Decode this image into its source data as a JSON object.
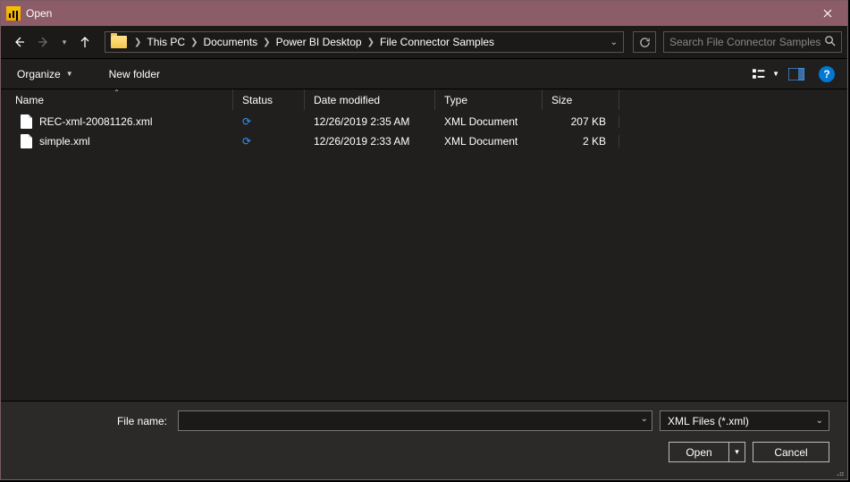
{
  "titlebar": {
    "title": "Open"
  },
  "breadcrumbs": [
    "This PC",
    "Documents",
    "Power BI Desktop",
    "File Connector Samples"
  ],
  "search": {
    "placeholder": "Search File Connector Samples"
  },
  "toolbar": {
    "organize": "Organize",
    "newfolder": "New folder"
  },
  "columns": {
    "name": "Name",
    "status": "Status",
    "date": "Date modified",
    "type": "Type",
    "size": "Size"
  },
  "files": [
    {
      "name": "REC-xml-20081126.xml",
      "date": "12/26/2019 2:35 AM",
      "type": "XML Document",
      "size": "207 KB"
    },
    {
      "name": "simple.xml",
      "date": "12/26/2019 2:33 AM",
      "type": "XML Document",
      "size": "2 KB"
    }
  ],
  "bottom": {
    "filename_label": "File name:",
    "filter": "XML Files (*.xml)",
    "open": "Open",
    "cancel": "Cancel"
  }
}
